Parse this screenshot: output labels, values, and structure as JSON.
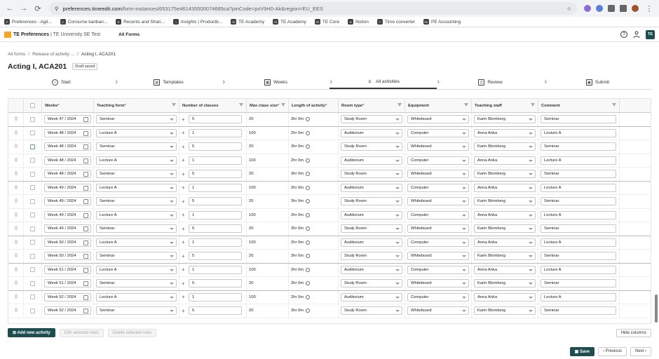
{
  "browser": {
    "url_main": "preferences.timeedit.com",
    "url_rest": "/form-instances/653175e461435500074685ca?pinCode=pxV9H0-Ak&region=EU_EES",
    "bookmarks": [
      {
        "label": "Preferences - Agil...",
        "icon": "P"
      },
      {
        "label": "Consume kanban...",
        "icon": "C"
      },
      {
        "label": "Recents and Shari...",
        "icon": "R"
      },
      {
        "label": "Insights | Productb...",
        "icon": "I"
      },
      {
        "label": "TE Academy",
        "icon": "TE"
      },
      {
        "label": "TE Academy",
        "icon": "TE"
      },
      {
        "label": "TE Core",
        "icon": "TE"
      },
      {
        "label": "Notion",
        "icon": "N"
      },
      {
        "label": "Time converter",
        "icon": "T"
      },
      {
        "label": "PE Accounting",
        "icon": "PE"
      }
    ]
  },
  "app": {
    "name": "TE Preferences",
    "org": "| TE University SE Test",
    "all_forms": "All Forms",
    "avatar": "TE"
  },
  "breadcrumb": {
    "items": [
      "All forms",
      "/",
      "Release of activity ...",
      "/",
      "Acting I, ACA201"
    ]
  },
  "page": {
    "title": "Acting I, ACA201",
    "status": "Draft saved"
  },
  "steps": [
    {
      "label": "Start",
      "icon": "info-icon"
    },
    {
      "label": "Templates",
      "icon": "templates-icon"
    },
    {
      "label": "Weeks",
      "icon": "calendar-icon"
    },
    {
      "label": "All activities",
      "icon": "list-icon"
    },
    {
      "label": "Review",
      "icon": "review-icon"
    },
    {
      "label": "Submit",
      "icon": "submit-icon"
    }
  ],
  "table": {
    "headers": {
      "weeks": "Weeks",
      "teaching_form": "Teaching form",
      "num_classes": "Number of classes",
      "max_class_size": "Max class size",
      "length": "Length of activity",
      "room_type": "Room type",
      "equipment": "Equipment",
      "teaching_staff": "Teaching staff",
      "comment": "Comment",
      "req": "*"
    },
    "rows": [
      {
        "week": "Week 47 / 2024",
        "form": "Seminar",
        "classes": "5",
        "size": "20",
        "length": "3hr 0m",
        "room": "Study Room",
        "equip": "Whiteboard",
        "staff": "Karin Blomberg",
        "comment": "Seminar"
      },
      {
        "week": "Week 48 / 2024",
        "form": "Lecture A",
        "classes": "1",
        "size": "100",
        "length": "2hr 0m",
        "room": "Auditorium",
        "equip": "Computer",
        "staff": "Anna Anka",
        "comment": "Lecture A"
      },
      {
        "week": "Week 48 / 2024",
        "form": "Seminar",
        "classes": "5",
        "size": "20",
        "length": "3hr 0m",
        "room": "Study Room",
        "equip": "Whiteboard",
        "staff": "Karin Blomberg",
        "comment": "Seminar"
      },
      {
        "week": "Week 48 / 2024",
        "form": "Lecture A",
        "classes": "1",
        "size": "100",
        "length": "2hr 0m",
        "room": "Auditorium",
        "equip": "Computer",
        "staff": "Anna Anka",
        "comment": "Lecture A"
      },
      {
        "week": "Week 48 / 2024",
        "form": "Seminar",
        "classes": "5",
        "size": "20",
        "length": "3hr 0m",
        "room": "Study Room",
        "equip": "Whiteboard",
        "staff": "Karin Blomberg",
        "comment": "Seminar"
      },
      {
        "week": "Week 49 / 2024",
        "form": "Lecture A",
        "classes": "1",
        "size": "100",
        "length": "2hr 0m",
        "room": "Auditorium",
        "equip": "Computer",
        "staff": "Anna Anka",
        "comment": "Lecture A"
      },
      {
        "week": "Week 49 / 2024",
        "form": "Seminar",
        "classes": "5",
        "size": "20",
        "length": "3hr 0m",
        "room": "Study Room",
        "equip": "Whiteboard",
        "staff": "Karin Blomberg",
        "comment": "Seminar"
      },
      {
        "week": "Week 49 / 2024",
        "form": "Lecture A",
        "classes": "1",
        "size": "100",
        "length": "2hr 0m",
        "room": "Auditorium",
        "equip": "Computer",
        "staff": "Anna Anka",
        "comment": "Lecture A"
      },
      {
        "week": "Week 49 / 2024",
        "form": "Seminar",
        "classes": "5",
        "size": "20",
        "length": "3hr 0m",
        "room": "Study Room",
        "equip": "Whiteboard",
        "staff": "Karin Blomberg",
        "comment": "Seminar"
      },
      {
        "week": "Week 50 / 2024",
        "form": "Lecture A",
        "classes": "1",
        "size": "100",
        "length": "2hr 0m",
        "room": "Auditorium",
        "equip": "Computer",
        "staff": "Anna Anka",
        "comment": "Lecture A"
      },
      {
        "week": "Week 50 / 2024",
        "form": "Seminar",
        "classes": "5",
        "size": "20",
        "length": "3hr 0m",
        "room": "Study Room",
        "equip": "Whiteboard",
        "staff": "Karin Blomberg",
        "comment": "Seminar"
      },
      {
        "week": "Week 51 / 2024",
        "form": "Lecture A",
        "classes": "1",
        "size": "100",
        "length": "2hr 0m",
        "room": "Auditorium",
        "equip": "Computer",
        "staff": "Anna Anka",
        "comment": "Lecture A"
      },
      {
        "week": "Week 51 / 2024",
        "form": "Seminar",
        "classes": "5",
        "size": "20",
        "length": "3hr 0m",
        "room": "Study Room",
        "equip": "Whiteboard",
        "staff": "Karin Blomberg",
        "comment": "Seminar"
      },
      {
        "week": "Week 52 / 2024",
        "form": "Lecture A",
        "classes": "1",
        "size": "100",
        "length": "2hr 0m",
        "room": "Auditorium",
        "equip": "Computer",
        "staff": "Anna Anka",
        "comment": "Lecture A"
      },
      {
        "week": "Week 52 / 2024",
        "form": "Seminar",
        "classes": "5",
        "size": "20",
        "length": "3hr 0m",
        "room": "Study Room",
        "equip": "Whiteboard",
        "staff": "Karin Blomberg",
        "comment": "Seminar"
      }
    ]
  },
  "actions": {
    "add_new": "Add new activity",
    "edit_selected": "Edit selected rows",
    "delete_selected": "Delete selected rows",
    "hide_columns": "Hide columns",
    "save": "Save",
    "previous": "Previous",
    "next": "Next"
  },
  "colors": {
    "primary": "#1d4d4f",
    "accent": "#f5a623",
    "required": "#c0392b"
  }
}
